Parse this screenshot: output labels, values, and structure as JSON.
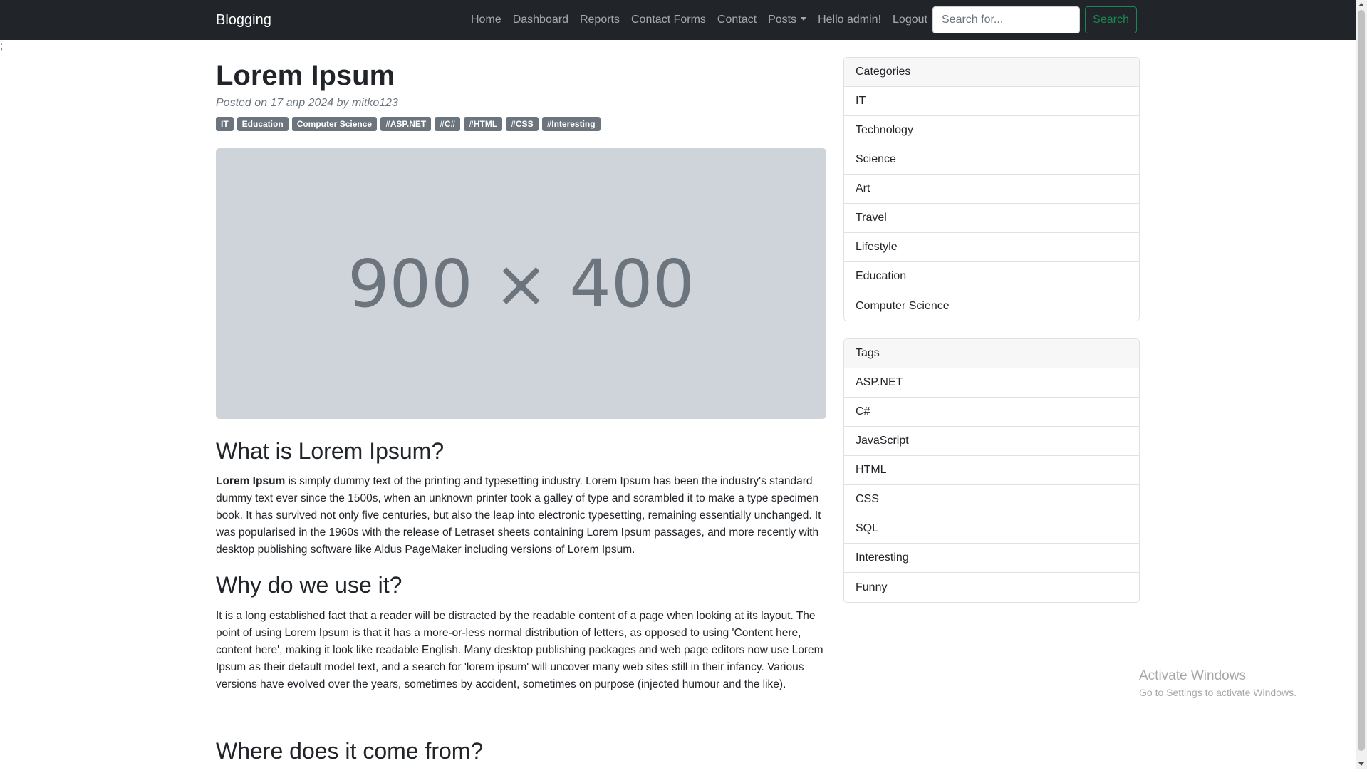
{
  "navbar": {
    "brand": "Blogging",
    "links": [
      "Home",
      "Dashboard",
      "Reports",
      "Contact Forms",
      "Contact",
      "Posts",
      "Hello admin!",
      "Logout"
    ],
    "search_placeholder": "Search for...",
    "search_button": "Search"
  },
  "stray_text": ";",
  "post": {
    "title": "Lorem Ipsum",
    "meta": "Posted on 17 апр 2024 by mitko123",
    "tags": [
      "IT",
      "Education",
      "Computer Science",
      "#ASP.NET",
      "#C#",
      "#HTML",
      "#CSS",
      "#Interesting"
    ],
    "image_placeholder": "900 × 400",
    "sections": [
      {
        "heading": "What is Lorem Ipsum?",
        "lead_bold": "Lorem Ipsum",
        "text": " is simply dummy text of the printing and typesetting industry. Lorem Ipsum has been the industry's standard dummy text ever since the 1500s, when an unknown printer took a galley of type and scrambled it to make a type specimen book. It has survived not only five centuries, but also the leap into electronic typesetting, remaining essentially unchanged. It was popularised in the 1960s with the release of Letraset sheets containing Lorem Ipsum passages, and more recently with desktop publishing software like Aldus PageMaker including versions of Lorem Ipsum."
      },
      {
        "heading": "Why do we use it?",
        "text": "It is a long established fact that a reader will be distracted by the readable content of a page when looking at its layout. The point of using Lorem Ipsum is that it has a more-or-less normal distribution of letters, as opposed to using 'Content here, content here', making it look like readable English. Many desktop publishing packages and web page editors now use Lorem Ipsum as their default model text, and a search for 'lorem ipsum' will uncover many web sites still in their infancy. Various versions have evolved over the years, sometimes by accident, sometimes on purpose (injected humour and the like)."
      },
      {
        "heading": "Where does it come from?"
      }
    ]
  },
  "sidebar": {
    "categories": {
      "header": "Categories",
      "items": [
        "IT",
        "Technology",
        "Science",
        "Art",
        "Travel",
        "Lifestyle",
        "Education",
        "Computer Science"
      ]
    },
    "tags": {
      "header": "Tags",
      "items": [
        "ASP.NET",
        "C#",
        "JavaScript",
        "HTML",
        "CSS",
        "SQL",
        "Interesting",
        "Funny"
      ]
    }
  },
  "watermark": {
    "title": "Activate Windows",
    "subtitle": "Go to Settings to activate Windows."
  }
}
